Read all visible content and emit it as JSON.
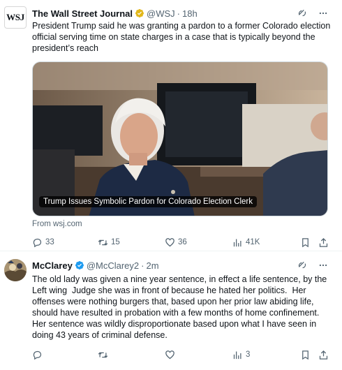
{
  "tweets": [
    {
      "avatar_text": "WSJ",
      "name": "The Wall Street Journal",
      "badge": "gold-verified",
      "handle": "@WSJ",
      "separator": "·",
      "time": "18h",
      "text": "President Trump said he was granting a pardon to a former Colorado election official serving time on state charges in a case that is typically beyond the president’s reach",
      "card_title": "Trump Issues Symbolic Pardon for Colorado Election Clerk",
      "from": "From wsj.com",
      "reply_count": "33",
      "repost_count": "15",
      "like_count": "36",
      "views_count": "41K"
    },
    {
      "name": "McClarey",
      "badge": "blue-verified",
      "handle": "@McClarey2",
      "separator": "·",
      "time": "2m",
      "text": "The old lady was given a nine year sentence, in effect a life sentence, by the Left wing  Judge she was in front of because he hated her politics.  Her offenses were nothing burgers that, based upon her prior law abiding life, should have resulted in probation with a few months of home confinement.  Her sentence was wildly disproportionate based upon what I have seen in doing 43 years of criminal defense.",
      "reply_count": "",
      "repost_count": "",
      "like_count": "",
      "views_count": "3"
    }
  ],
  "colors": {
    "text": "#0f1419",
    "muted": "#536471",
    "gold_badge": "#e2b719",
    "blue_badge": "#1d9bf0",
    "divider": "#eff3f4"
  },
  "icons": [
    "grok-icon",
    "more-icon",
    "reply-icon",
    "repost-icon",
    "like-icon",
    "views-icon",
    "bookmark-icon",
    "share-icon"
  ]
}
